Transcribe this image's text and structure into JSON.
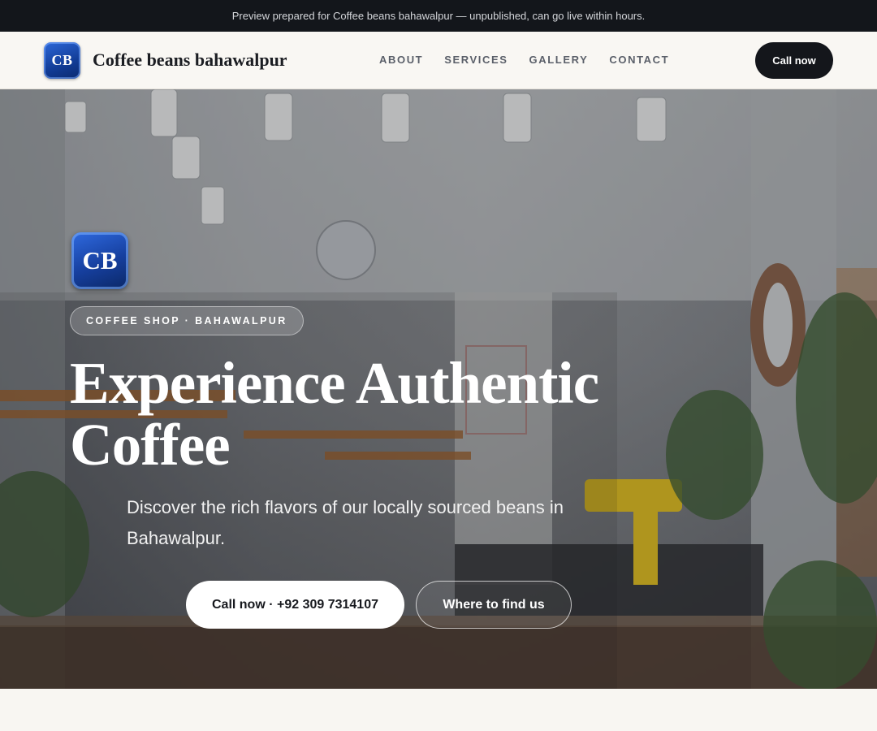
{
  "banner": {
    "text": "Preview prepared for Coffee beans bahawalpur — unpublished, can go live within hours."
  },
  "nav": {
    "logo_initials": "CB",
    "brand": "Coffee beans bahawalpur",
    "links": [
      {
        "label": "ABOUT"
      },
      {
        "label": "SERVICES"
      },
      {
        "label": "GALLERY"
      },
      {
        "label": "CONTACT"
      }
    ],
    "cta_label": "Call now"
  },
  "hero": {
    "logo_initials": "CB",
    "eyebrow": "COFFEE SHOP · BAHAWALPUR",
    "headline_line1": "Experience Authentic",
    "headline_line2": "Coffee",
    "subtitle": "Discover the rich flavors of our locally sourced beans in Bahawalpur.",
    "primary_button": "Call now · +92 309 7314107",
    "secondary_button": "Where to find us"
  },
  "colors": {
    "banner_bg": "#13161b",
    "nav_bg": "#f9f7f3",
    "dark_button": "#14161b",
    "logo_blue": "#123c96",
    "page_bg": "#f8f6f2"
  }
}
